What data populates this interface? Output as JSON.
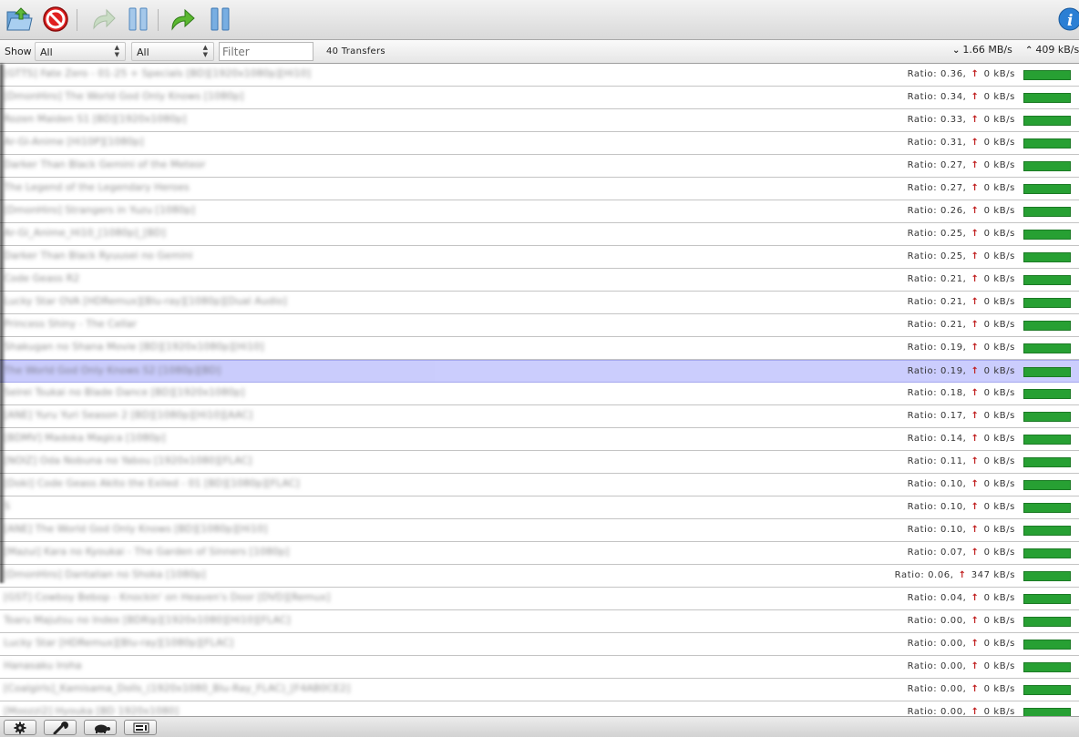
{
  "toolbar": {
    "buttons": [
      {
        "icon": "open-folder-icon"
      },
      {
        "icon": "remove-stop-icon"
      },
      {
        "icon": "start-icon"
      },
      {
        "icon": "pause-icon"
      },
      {
        "icon": "start-all-icon"
      },
      {
        "icon": "pause-all-icon"
      },
      {
        "icon": "info-icon"
      }
    ]
  },
  "filter_bar": {
    "show_label": "Show",
    "filter1_value": "All",
    "filter2_value": "All",
    "search_placeholder": "Filter",
    "transfers_count": "40 Transfers",
    "download_arrow": "⌄",
    "download_speed": "1.66 MB/s",
    "upload_arrow": "⌃",
    "upload_speed": "409 kB/s"
  },
  "transfers": [
    {
      "name": "[GTTS] Fate Zero - 01-25 + Specials [BD][1920x1080p][Hi10]",
      "stat_prefix": "Ratio: 0.36,",
      "upload": "0 kB/s",
      "progress": 1.0
    },
    {
      "name": "[DmonHiro] The World God Only Knows [1080p]",
      "stat_prefix": "Ratio: 0.34,",
      "upload": "0 kB/s",
      "progress": 1.0
    },
    {
      "name": "Rozen Maiden S1 [BD][1920x1080p]",
      "stat_prefix": "Ratio: 0.33,",
      "upload": "0 kB/s",
      "progress": 1.0
    },
    {
      "name": "Ar-Gi-Anime [Hi10P][1080p]",
      "stat_prefix": "Ratio: 0.31,",
      "upload": "0 kB/s",
      "progress": 1.0
    },
    {
      "name": "Darker Than Black Gemini of the Meteor",
      "stat_prefix": "Ratio: 0.27,",
      "upload": "0 kB/s",
      "progress": 1.0
    },
    {
      "name": "The Legend of the Legendary Heroes",
      "stat_prefix": "Ratio: 0.27,",
      "upload": "0 kB/s",
      "progress": 1.0
    },
    {
      "name": "[DmonHiro] Strangers in Yuzu [1080p]",
      "stat_prefix": "Ratio: 0.26,",
      "upload": "0 kB/s",
      "progress": 1.0
    },
    {
      "name": "Ar-Gi_Anime_Hi10_[1080p]_[BD]",
      "stat_prefix": "Ratio: 0.25,",
      "upload": "0 kB/s",
      "progress": 1.0
    },
    {
      "name": "Darker Than Black Ryuusei no Gemini",
      "stat_prefix": "Ratio: 0.25,",
      "upload": "0 kB/s",
      "progress": 1.0
    },
    {
      "name": "Code Geass R2",
      "stat_prefix": "Ratio: 0.21,",
      "upload": "0 kB/s",
      "progress": 1.0
    },
    {
      "name": "Lucky Star OVA [HDRemux][Blu-ray][1080p][Dual Audio]",
      "stat_prefix": "Ratio: 0.21,",
      "upload": "0 kB/s",
      "progress": 1.0
    },
    {
      "name": "Princess Shiny - The Cellar",
      "stat_prefix": "Ratio: 0.21,",
      "upload": "0 kB/s",
      "progress": 1.0
    },
    {
      "name": "Shakugan no Shana Movie [BD][1920x1080p][Hi10]",
      "stat_prefix": "Ratio: 0.19,",
      "upload": "0 kB/s",
      "progress": 1.0
    },
    {
      "name": "The World God Only Knows S2 [1080p][BD]",
      "stat_prefix": "Ratio: 0.19,",
      "upload": "0 kB/s",
      "progress": 1.0,
      "selected": true
    },
    {
      "name": "Seirei Tsukai no Blade Dance [BD][1920x1080p]",
      "stat_prefix": "Ratio: 0.18,",
      "upload": "0 kB/s",
      "progress": 1.0
    },
    {
      "name": "[ANE] Yuru Yuri Season 2 [BD][1080p][Hi10][AAC]",
      "stat_prefix": "Ratio: 0.17,",
      "upload": "0 kB/s",
      "progress": 1.0
    },
    {
      "name": "[BDMV] Madoka Magica [1080p]",
      "stat_prefix": "Ratio: 0.14,",
      "upload": "0 kB/s",
      "progress": 1.0
    },
    {
      "name": "[NOIZ] Oda Nobuna no Yabou [1920x1080][FLAC]",
      "stat_prefix": "Ratio: 0.11,",
      "upload": "0 kB/s",
      "progress": 1.0
    },
    {
      "name": "[Doki] Code Geass Akito the Exiled - 01 [BD][1080p][FLAC]",
      "stat_prefix": "Ratio: 0.10,",
      "upload": "0 kB/s",
      "progress": 1.0
    },
    {
      "name": "S",
      "stat_prefix": "Ratio: 0.10,",
      "upload": "0 kB/s",
      "progress": 1.0
    },
    {
      "name": "[ANE] The World God Only Knows [BD][1080p][Hi10]",
      "stat_prefix": "Ratio: 0.10,",
      "upload": "0 kB/s",
      "progress": 1.0
    },
    {
      "name": "[Mazui] Kara no Kyoukai - The Garden of Sinners [1080p]",
      "stat_prefix": "Ratio: 0.07,",
      "upload": "0 kB/s",
      "progress": 1.0
    },
    {
      "name": "[DmonHiro] Dantalian no Shoka [1080p]",
      "stat_prefix": "Ratio: 0.06,",
      "upload": "347 kB/s",
      "progress": 1.0
    },
    {
      "name": "[GST] Cowboy Bebop - Knockin' on Heaven's Door [DVD][Remux]",
      "stat_prefix": "Ratio: 0.04,",
      "upload": "0 kB/s",
      "progress": 1.0
    },
    {
      "name": "Toaru Majutsu no Index [BDRip][1920x1080][Hi10][FLAC]",
      "stat_prefix": "Ratio: 0.00,",
      "upload": "0 kB/s",
      "progress": 1.0
    },
    {
      "name": "Lucky Star [HDRemux][Blu-ray][1080p][FLAC]",
      "stat_prefix": "Ratio: 0.00,",
      "upload": "0 kB/s",
      "progress": 1.0
    },
    {
      "name": "Hanasaku Iroha",
      "stat_prefix": "Ratio: 0.00,",
      "upload": "0 kB/s",
      "progress": 1.0
    },
    {
      "name": "[Coalgirls]_Kamisama_Dolls_(1920x1080_Blu-Ray_FLAC)_[F4AB0CE2]",
      "stat_prefix": "Ratio: 0.00,",
      "upload": "0 kB/s",
      "progress": 1.0
    },
    {
      "name": "[Moozzi2] Hyouka [BD 1920x1080]",
      "stat_prefix": "Ratio: 0.00,",
      "upload": "0 kB/s",
      "progress": 1.0
    }
  ],
  "bottom_bar": {
    "buttons": [
      {
        "icon": "gear-icon"
      },
      {
        "icon": "wrench-icon"
      },
      {
        "icon": "turtle-icon"
      },
      {
        "icon": "compact-view-icon"
      }
    ]
  },
  "colors": {
    "progress_bar": "#27a033",
    "selection": "#cbcdfd",
    "upload_arrow": "#c01f1f"
  }
}
